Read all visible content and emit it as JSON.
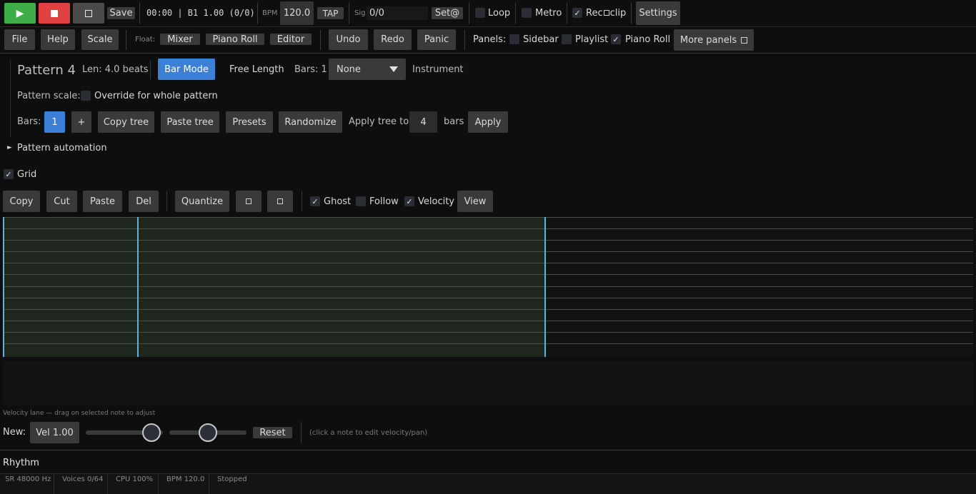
{
  "transport": {
    "save_label": "Save",
    "position": "00:00 | B1 1.00 (0/0)",
    "bpm_label": "BPM",
    "bpm_value": "120.0",
    "tap_label": "TAP",
    "sig_label": "Sig",
    "sig_value": "0/0",
    "set_label": "Set@",
    "loop_label": "Loop",
    "metro_label": "Metro",
    "rec_label": "Rec",
    "clip_label": "clip",
    "settings_label": "Settings",
    "colors": {
      "play": "#3fae49",
      "stop": "#e0403f",
      "accent": "#3c7fd6"
    }
  },
  "menubar": {
    "file": "File",
    "help": "Help",
    "scale": "Scale",
    "float_label": "Float:",
    "mixer": "Mixer",
    "piano_roll": "Piano Roll",
    "editor": "Editor",
    "undo": "Undo",
    "redo": "Redo",
    "panic": "Panic",
    "panels_label": "Panels:",
    "sidebar": "Sidebar",
    "playlist": "Playlist",
    "piano_roll_panel": "Piano Roll",
    "more_panels": "More panels"
  },
  "pattern": {
    "name": "Pattern 4",
    "length": "Len: 4.0 beats",
    "bar_mode": "Bar Mode",
    "free_length": "Free Length",
    "bars_count": "Bars: 1",
    "instrument_value": "None",
    "instrument_label": "Instrument",
    "scale_label": "Pattern scale:",
    "override_label": "Override for whole pattern",
    "bars_label": "Bars:",
    "bar_1": "1",
    "add_bar": "+",
    "copy_tree": "Copy tree",
    "paste_tree": "Paste tree",
    "presets": "Presets",
    "randomize": "Randomize",
    "apply_tree_to": "Apply tree to",
    "apply_bars_value": "4",
    "bars_suffix": "bars",
    "apply": "Apply",
    "automation": "Pattern automation"
  },
  "editor": {
    "grid_label": "Grid",
    "copy": "Copy",
    "cut": "Cut",
    "paste": "Paste",
    "del": "Del",
    "quantize": "Quantize",
    "ghost": "Ghost",
    "follow": "Follow",
    "velocity": "Velocity",
    "view": "View"
  },
  "velocity": {
    "hint": "Velocity lane — drag on selected note to adjust",
    "new_label": "New:",
    "vel_value": "Vel 1.00",
    "reset": "Reset",
    "edit_hint": "(click a note to edit velocity/pan)",
    "vel_slider_value": 0.85,
    "pan_slider_value": 0.5
  },
  "rhythm_label": "Rhythm",
  "status": {
    "sr": "SR 48000 Hz",
    "voices": "Voices 0/64",
    "cpu": "CPU 100%",
    "bpm": "BPM 120.0",
    "state": "Stopped"
  }
}
